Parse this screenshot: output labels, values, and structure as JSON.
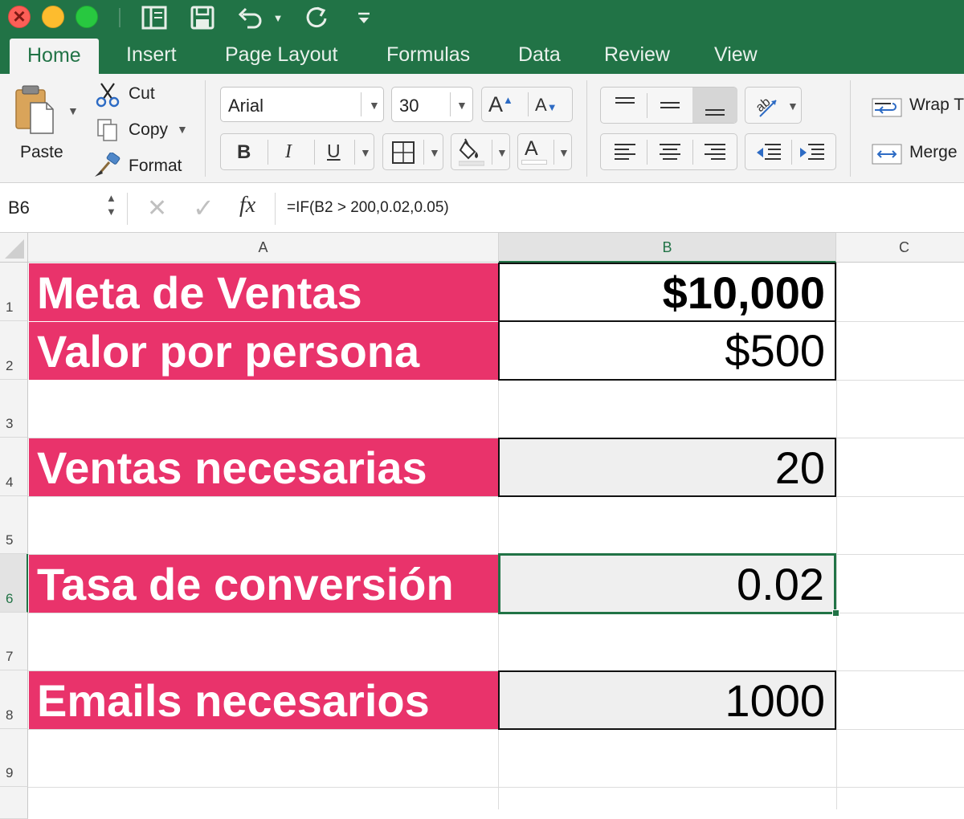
{
  "ribbon": {
    "tabs": [
      {
        "label": "Home"
      },
      {
        "label": "Insert"
      },
      {
        "label": "Page Layout"
      },
      {
        "label": "Formulas"
      },
      {
        "label": "Data"
      },
      {
        "label": "Review"
      },
      {
        "label": "View"
      }
    ],
    "clipboard": {
      "paste": "Paste",
      "cut": "Cut",
      "copy": "Copy",
      "format": "Format"
    },
    "font": {
      "name": "Arial",
      "size": "30",
      "bold": "B",
      "italic": "I",
      "underline": "U",
      "grow": "A",
      "shrink": "A",
      "font_color_glyph": "A"
    },
    "alignment": {
      "wrap": "Wrap T",
      "merge": "Merge"
    }
  },
  "formula_bar": {
    "name_box": "B6",
    "fx": "fx",
    "formula": "=IF(B2 > 200,0.02,0.05)"
  },
  "columns": [
    "A",
    "B",
    "C"
  ],
  "rows": [
    "1",
    "2",
    "3",
    "4",
    "5",
    "6",
    "7",
    "8",
    "9"
  ],
  "cells": {
    "A1": "Meta de Ventas",
    "B1": "$10,000",
    "A2": "Valor por persona",
    "B2": "$500",
    "A4": "Ventas necesarias",
    "B4": "20",
    "A6": "Tasa de conversión",
    "B6": "0.02",
    "A8": "Emails necesarios",
    "B8": "1000"
  },
  "colors": {
    "excel_green": "#217346",
    "label_fill": "#e9336b",
    "computed_fill": "#efefef"
  },
  "selected_cell": "B6"
}
